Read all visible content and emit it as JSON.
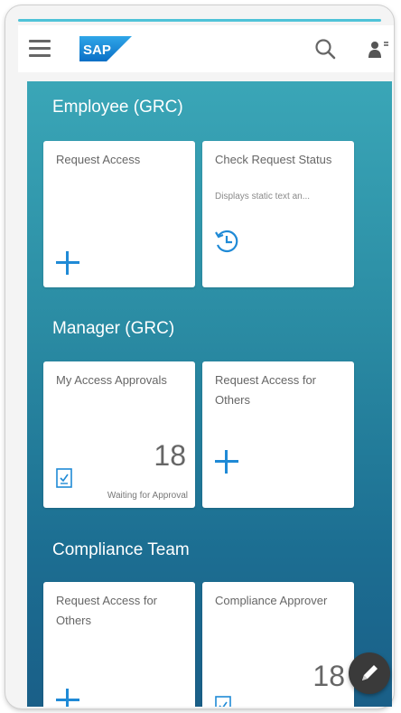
{
  "header": {
    "menu_icon": "hamburger-menu-icon",
    "logo_text": "SAP",
    "search_icon": "search-icon",
    "user_icon": "user-menu-icon"
  },
  "groups": [
    {
      "title": "Employee (GRC)",
      "tiles": [
        {
          "title": "Request Access",
          "subtitle": "",
          "icon": "plus-icon"
        },
        {
          "title": "Check Request Status",
          "subtitle": "Displays static text an...",
          "icon": "history-clock-icon"
        }
      ]
    },
    {
      "title": "Manager (GRC)",
      "tiles": [
        {
          "title": "My Access Approvals",
          "number": "18",
          "footer": "Waiting for Approval",
          "icon": "approvals-document-icon"
        },
        {
          "title": "Request Access for Others",
          "icon": "plus-icon"
        }
      ]
    },
    {
      "title": "Compliance Team",
      "tiles": [
        {
          "title": "Request Access for Others",
          "icon": "plus-icon"
        },
        {
          "title": "Compliance Approver",
          "number": "18",
          "icon": "approvals-document-icon"
        }
      ]
    }
  ],
  "colors": {
    "accent": "#1f8ad6",
    "topline": "#4fc3d8",
    "gradient_top": "#3aa6b7",
    "gradient_bottom": "#1a5f88",
    "fab": "#3a3a3a"
  },
  "edit_fab_icon": "pencil-edit-icon"
}
